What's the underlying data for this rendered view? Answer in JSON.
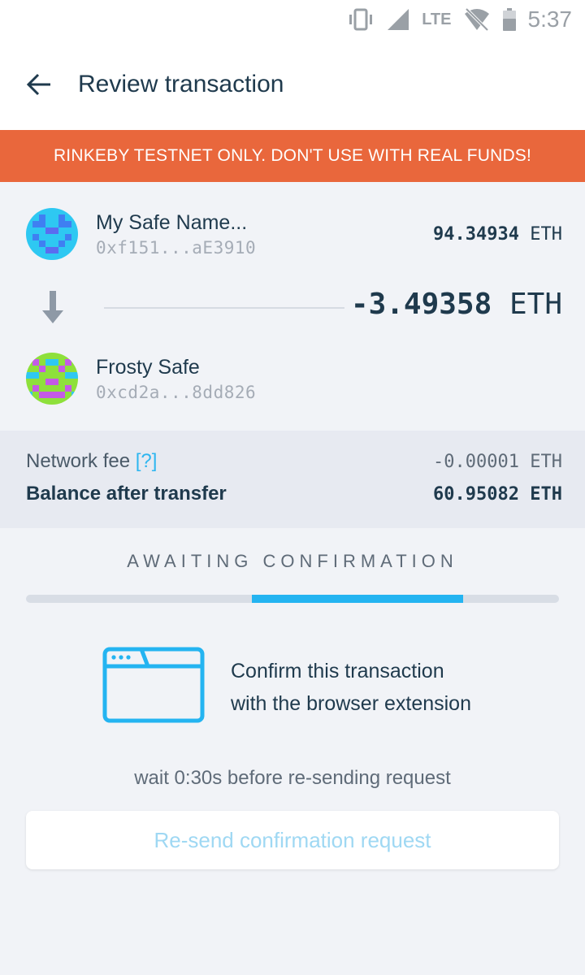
{
  "status_bar": {
    "network": "LTE",
    "time": "5:37",
    "icons": [
      "vibrate-icon",
      "signal-icon",
      "wifi-off-icon",
      "battery-icon"
    ]
  },
  "app_bar": {
    "title": "Review transaction",
    "back_icon": "arrow-left-icon"
  },
  "warning_banner": "RINKEBY TESTNET ONLY. DON'T USE WITH REAL FUNDS!",
  "transaction": {
    "from": {
      "name": "My Safe Name...",
      "address": "0xf151...aE3910",
      "balance": "94.34934",
      "currency": "ETH"
    },
    "amount": "-3.49358",
    "amount_currency": "ETH",
    "to": {
      "name": "Frosty Safe",
      "address": "0xcd2a...8dd826"
    }
  },
  "fees": {
    "network_fee_label": "Network fee",
    "network_fee_help": "[?]",
    "network_fee_value": "-0.00001",
    "network_fee_currency": "ETH",
    "balance_after_label": "Balance after transfer",
    "balance_after_value": "60.95082",
    "balance_after_currency": "ETH"
  },
  "status": {
    "title": "AWAITING CONFIRMATION",
    "progress_start": 0.424,
    "progress_end": 0.82
  },
  "confirm": {
    "line1": "Confirm this transaction",
    "line2": "with the browser extension",
    "icon": "browser-window-icon"
  },
  "wait_text": "wait 0:30s before re-sending request",
  "resend_button": "Re-send confirmation request",
  "colors": {
    "banner": "#e9673c",
    "accent": "#24b4f1",
    "text_dark": "#1f3a4d",
    "resend_disabled": "#9fd8f3"
  }
}
